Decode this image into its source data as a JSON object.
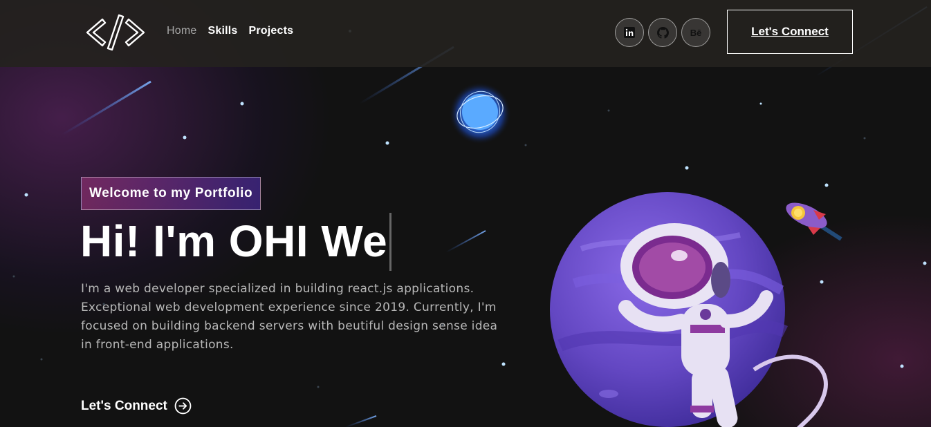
{
  "nav": {
    "links": [
      {
        "label": "Home",
        "active": true
      },
      {
        "label": "Skills",
        "active": false
      },
      {
        "label": "Projects",
        "active": false
      }
    ],
    "socials": [
      "linkedin-icon",
      "github-icon",
      "behance-icon"
    ],
    "behance_label": "Bē",
    "cta_label": "Let's Connect"
  },
  "hero": {
    "tagline": "Welcome to my Portfolio",
    "headline": "Hi! I'm OHI We",
    "bio": "I'm a web developer specialized in building react.js applications. Exceptional web development experience since 2019. Currently, I'm focused on building backend servers with beutiful design sense idea in front-end applications.",
    "cta_label": "Let's Connect"
  },
  "colors": {
    "background": "#121212",
    "navbar": "#24221e",
    "accent_pink": "#aa367c",
    "accent_purple": "#4a2fbd",
    "planet": "#6a4fc8"
  }
}
